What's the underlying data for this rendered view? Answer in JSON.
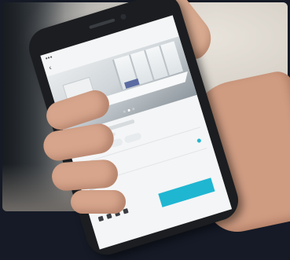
{
  "scene": {
    "subject": "",
    "phone_color": "#1b1d20",
    "skin_tone": "#d6a58c"
  },
  "app": {
    "status_bar": {
      "carrier": "●●●",
      "time": "",
      "battery": ""
    },
    "nav_title": "",
    "accent_color": "#1fb6d2",
    "pager": {
      "count": 3,
      "active": 1
    },
    "schedule": {
      "label": "",
      "status": ""
    },
    "capacity": [
      {
        "icon": "seat-icon",
        "text": ""
      },
      {
        "icon": "people-icon",
        "text": ""
      }
    ],
    "book_button": {
      "label": ""
    }
  }
}
